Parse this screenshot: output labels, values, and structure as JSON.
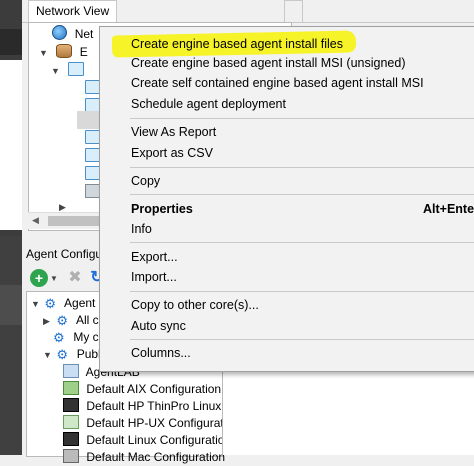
{
  "tabs": {
    "network_view": "Network View"
  },
  "top_tree": {
    "root_label": "Net",
    "db_label": "E"
  },
  "agent_config": {
    "header": "Agent Configu",
    "tree": {
      "root": "Agent C",
      "all": "All co",
      "my": "My co",
      "public": "Publi",
      "items": [
        "AgentLAB",
        "Default AIX Configuration",
        "Default HP ThinPro Linux Cor",
        "Default HP-UX Configuration",
        "Default Linux Configuration",
        "Default Mac Configuration"
      ]
    }
  },
  "context_menu": {
    "highlight_color": "#f7f329",
    "items": [
      {
        "label": "Create engine based agent install files"
      },
      {
        "label": "Create engine based agent install MSI (unsigned)"
      },
      {
        "label": "Create self contained engine based agent install MSI"
      },
      {
        "label": "Schedule agent deployment"
      },
      {
        "label": "View As Report"
      },
      {
        "label": "Export as CSV"
      },
      {
        "label": "Copy"
      },
      {
        "label": "Properties",
        "shortcut": "Alt+Enter"
      },
      {
        "label": "Info"
      },
      {
        "label": "Export..."
      },
      {
        "label": "Import..."
      },
      {
        "label": "Copy to other core(s)..."
      },
      {
        "label": "Auto sync"
      },
      {
        "label": "Columns..."
      }
    ]
  }
}
